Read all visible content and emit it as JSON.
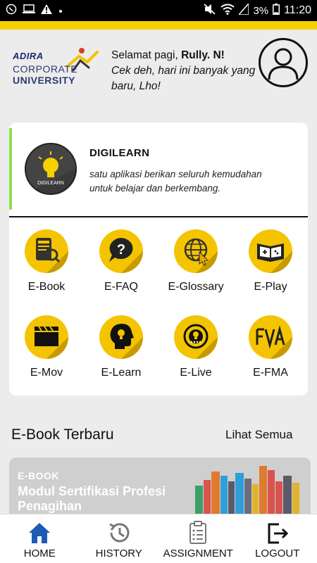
{
  "status_bar": {
    "battery": "3%",
    "time": "11:20"
  },
  "header": {
    "logo_text_top": "ADIRA",
    "logo_text_corporate": "CORPORATE",
    "logo_text_university": "UNIVERSITY",
    "greeting_prefix": "Selamat pagi, ",
    "user_name": "Rully. N!",
    "message": "Cek deh, hari ini banyak yang baru, Lho!"
  },
  "banner": {
    "logo_label": "DIGILEARN",
    "title": "DIGILEARN",
    "subtitle": "satu aplikasi berikan seluruh kemudahan untuk belajar dan berkembang."
  },
  "menu": [
    {
      "label": "E-Book",
      "icon": "ebook-icon"
    },
    {
      "label": "E-FAQ",
      "icon": "faq-icon"
    },
    {
      "label": "E-Glossary",
      "icon": "globe-icon"
    },
    {
      "label": "E-Play",
      "icon": "gamepad-icon"
    },
    {
      "label": "E-Mov",
      "icon": "clapperboard-icon"
    },
    {
      "label": "E-Learn",
      "icon": "lightbulb-head-icon"
    },
    {
      "label": "E-Live",
      "icon": "live-broadcast-icon"
    },
    {
      "label": "E-FMA",
      "icon": "fma-icon"
    }
  ],
  "section": {
    "title": "E-Book Terbaru",
    "see_all": "Lihat Semua"
  },
  "ebook": {
    "tag": "E-BOOK",
    "title": "Modul Sertifikasi Profesi Penagihan"
  },
  "bottom_nav": [
    {
      "label": "HOME",
      "icon": "home-icon",
      "active": true
    },
    {
      "label": "HISTORY",
      "icon": "history-icon",
      "active": false
    },
    {
      "label": "ASSIGNMENT",
      "icon": "clipboard-icon",
      "active": false
    },
    {
      "label": "LOGOUT",
      "icon": "logout-icon",
      "active": false
    }
  ],
  "colors": {
    "accent_yellow": "#f7d000",
    "icon_yellow": "#f4c400",
    "active_nav": "#1f5bb5",
    "banner_stripe": "#8ee04a"
  }
}
